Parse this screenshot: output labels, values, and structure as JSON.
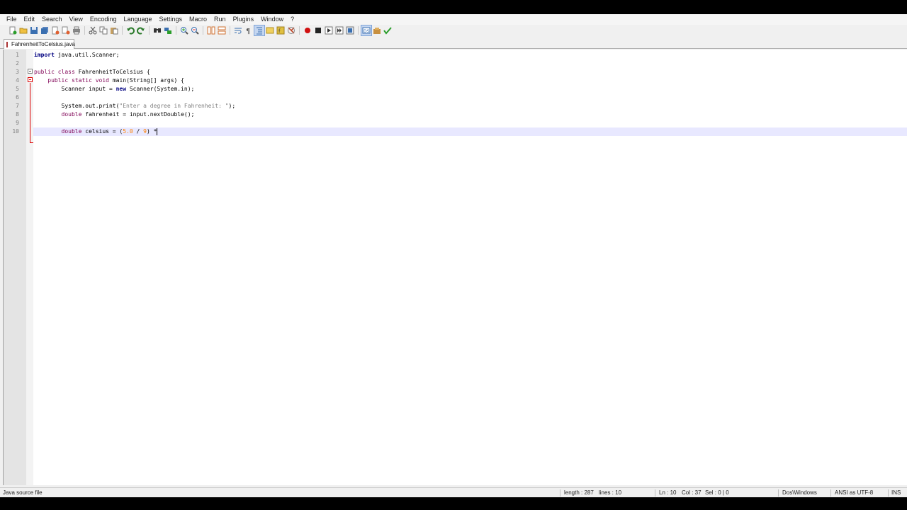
{
  "menu": [
    "File",
    "Edit",
    "Search",
    "View",
    "Encoding",
    "Language",
    "Settings",
    "Macro",
    "Run",
    "Plugins",
    "Window",
    "?"
  ],
  "toolbar": {
    "icons": [
      "new-file-icon",
      "open-file-icon",
      "save-icon",
      "save-all-icon",
      "close-icon",
      "close-all-icon",
      "print-icon",
      "cut-icon",
      "copy-icon",
      "paste-icon",
      "undo-icon",
      "redo-icon",
      "find-icon",
      "replace-icon",
      "zoom-in-icon",
      "zoom-out-icon",
      "sync-vertical-icon",
      "sync-horizontal-icon",
      "word-wrap-icon",
      "show-all-chars-icon",
      "indent-guide-icon",
      "doc-map-icon",
      "function-list-icon",
      "folder-as-workspace-icon",
      "record-macro-icon",
      "stop-record-icon",
      "play-macro-icon",
      "run-macro-multiple-icon",
      "save-macro-icon",
      "user-defined-language-icon",
      "plugin-icon",
      "spell-check-icon"
    ]
  },
  "tab": {
    "label": "FahrenheitToCelsius.java"
  },
  "editor": {
    "lines": [
      {
        "n": "1",
        "code": "import java.util.Scanner;"
      },
      {
        "n": "2",
        "code": ""
      },
      {
        "n": "3",
        "code": "public class FahrenheitToCelsius {"
      },
      {
        "n": "4",
        "code": "    public static void main(String[] args) {"
      },
      {
        "n": "5",
        "code": "        Scanner input = new Scanner(System.in);"
      },
      {
        "n": "6",
        "code": ""
      },
      {
        "n": "7",
        "code": "        System.out.print(\"Enter a degree in Fahrenheit: \");"
      },
      {
        "n": "8",
        "code": "        double fahrenheit = input.nextDouble();"
      },
      {
        "n": "9",
        "code": ""
      },
      {
        "n": "10",
        "code": "        double celsius = (5.0 / 9) *"
      }
    ],
    "current_line": 10
  },
  "status": {
    "file_type": "Java source file",
    "length": "length : 287",
    "lines": "lines : 10",
    "ln": "Ln : 10",
    "col": "Col : 37",
    "sel": "Sel : 0 | 0",
    "eol": "Dos\\Windows",
    "encoding": "ANSI as UTF-8",
    "mode": "INS"
  }
}
